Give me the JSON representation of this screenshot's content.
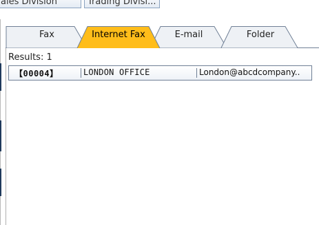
{
  "top_buttons": [
    {
      "label": "ales Division"
    },
    {
      "label": "Trading Divisi..."
    }
  ],
  "tabs": [
    {
      "label": "Fax",
      "active": false
    },
    {
      "label": "Internet Fax",
      "active": true
    },
    {
      "label": "E-mail",
      "active": false
    },
    {
      "label": "Folder",
      "active": false
    }
  ],
  "results_label": "Results: 1",
  "rows": [
    {
      "code": "【00004】",
      "name": "LONDON OFFICE",
      "email": "London@abcdcompany.."
    }
  ],
  "colors": {
    "active_tab": "#ffbd1a",
    "inactive_tab": "#eef1f5",
    "border": "#6f7f95",
    "accent_bar": "#1f3a5c"
  }
}
